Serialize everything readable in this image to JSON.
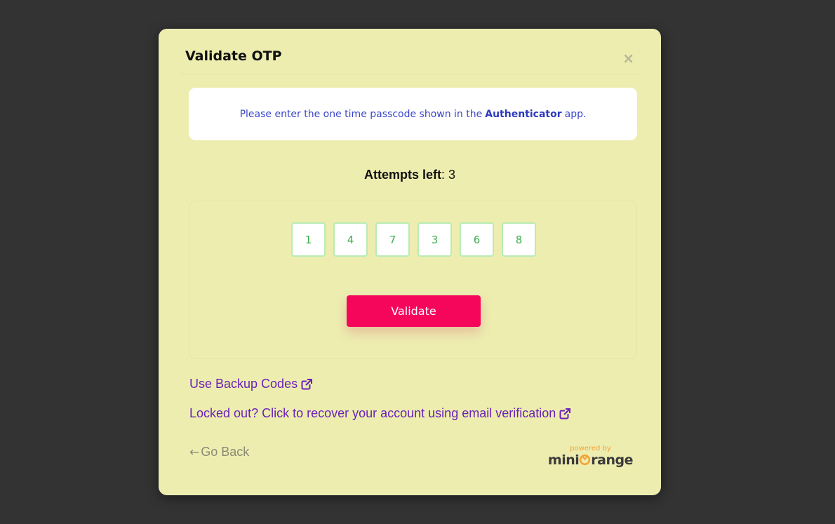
{
  "modal": {
    "title": "Validate OTP",
    "close_symbol": "×"
  },
  "info": {
    "prefix": "Please enter the one time passcode shown in the",
    "app_name": "Authenticator",
    "suffix": "app."
  },
  "attempts": {
    "label": "Attempts left",
    "separator": ":",
    "value": "3"
  },
  "otp": {
    "digits": [
      "1",
      "4",
      "7",
      "3",
      "6",
      "8"
    ],
    "input_border_color": "#b7ecb4",
    "digit_color": "#3fae4c"
  },
  "validate_button": {
    "label": "Validate",
    "color": "#f5065b"
  },
  "links": {
    "backup_codes": "Use Backup Codes",
    "recover": "Locked out? Click to recover your account using email verification",
    "icon": "external-link-icon",
    "color": "#6a21b8"
  },
  "footer": {
    "go_back_arrow": "←",
    "go_back_label": "Go Back",
    "powered_by": "powered by",
    "brand_prefix": "mini",
    "brand_suffix": "range",
    "brand_icon": "miniorange-logo-icon"
  },
  "colors": {
    "backdrop": "#333333",
    "modal_bg": "#ededb0",
    "info_text": "#3a46c9"
  }
}
